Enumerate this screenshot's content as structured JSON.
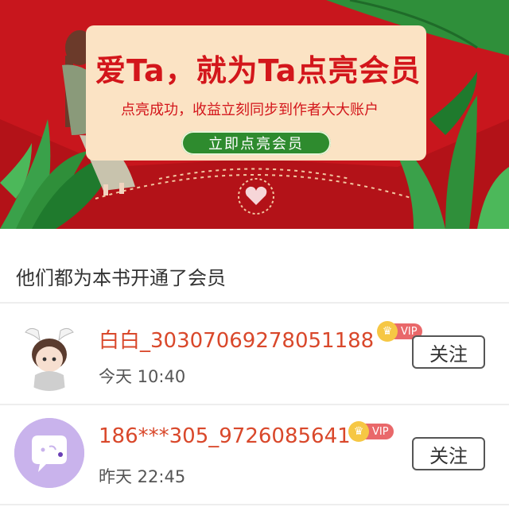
{
  "banner": {
    "headline": "爱Ta，就为Ta点亮会员",
    "subline": "点亮成功，收益立刻同步到作者大大账户",
    "cta_label": "立即点亮会员"
  },
  "section_title": "他们都为本书开通了会员",
  "members": [
    {
      "name": "白白_30307069278051188",
      "time": "今天 10:40",
      "vip_label": "VIP",
      "follow_label": "关注"
    },
    {
      "name": "186***305_9726085641",
      "time": "昨天 22:45",
      "vip_label": "VIP",
      "follow_label": "关注"
    }
  ],
  "colors": {
    "banner_red": "#c8161d",
    "card_cream": "#fbe3c4",
    "cta_green": "#2e8b2e",
    "name_orange": "#d9482b",
    "vip_pink": "#e9686a",
    "crown_gold": "#f6c744"
  },
  "icons": [
    "heart-seal-icon",
    "crown-icon",
    "chat-bubble-icon"
  ]
}
